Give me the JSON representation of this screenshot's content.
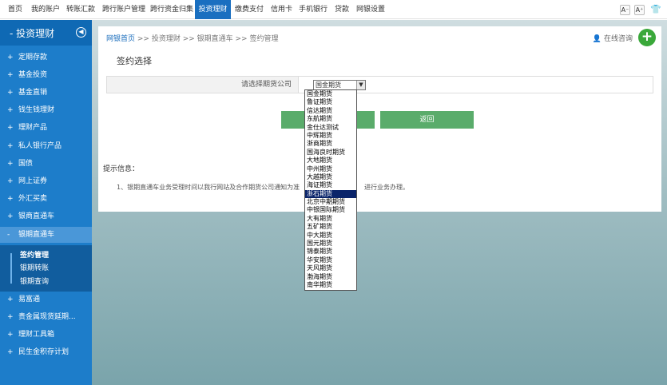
{
  "topnav": {
    "items": [
      "首页",
      "我的账户",
      "转账汇款",
      "跨行账户管理",
      "跨行资金归集",
      "投资理财",
      "缴费支付",
      "信用卡",
      "手机银行",
      "贷款",
      "网银设置"
    ],
    "font_small": "A⁻",
    "font_large": "A⁺",
    "skin_icon": "shirt-icon"
  },
  "sidebar": {
    "title": "投资理财",
    "collapse_icon": "circle-arrow-left-icon",
    "items": [
      "定期存款",
      "基金投资",
      "基金直销",
      "钱生钱理财",
      "理财产品",
      "私人银行产品",
      "国债",
      "网上证券",
      "外汇买卖",
      "银商直通车",
      "银期直通车",
      "易富通",
      "贵金属现货延期...",
      "理财工具箱",
      "民生金积存计划"
    ],
    "expanded_index": 10,
    "subitems": [
      "签约管理",
      "银期转账",
      "银期查询"
    ]
  },
  "breadcrumb": {
    "home": "网银首页",
    "rest": ">> 投资理财 >> 银期直通车 >> 签约管理"
  },
  "consult": "在线咨询",
  "page_title": "签约选择",
  "form": {
    "label": "请选择期货公司",
    "selected": "国金期货"
  },
  "buttons": {
    "confirm": "确定",
    "back": "返回"
  },
  "tips": {
    "title": "提示信息：",
    "line1": "1、银期直通车业务受理时间以我行网站及合作期货公司通知为准",
    "line2": "进行业务办理。"
  },
  "dropdown": {
    "options": [
      "国金期货",
      "鲁证期货",
      "信达期货",
      "东航期货",
      "金仕达测试",
      "中辉期货",
      "浙商期货",
      "国海良时期货",
      "大地期货",
      "中州期货",
      "大越期货",
      "海证期货",
      "浙石期货",
      "北京中期期货",
      "中银国际期货",
      "大有期货",
      "五矿期货",
      "中大期货",
      "国元期货",
      "锦泰期货",
      "华安期货",
      "天风期货",
      "渤海期货",
      "南华期货"
    ],
    "highlighted_index": 12
  },
  "colors": {
    "accent": "#1a6fc0",
    "sidebar": "#1d7dca",
    "button": "#5aac6b"
  }
}
